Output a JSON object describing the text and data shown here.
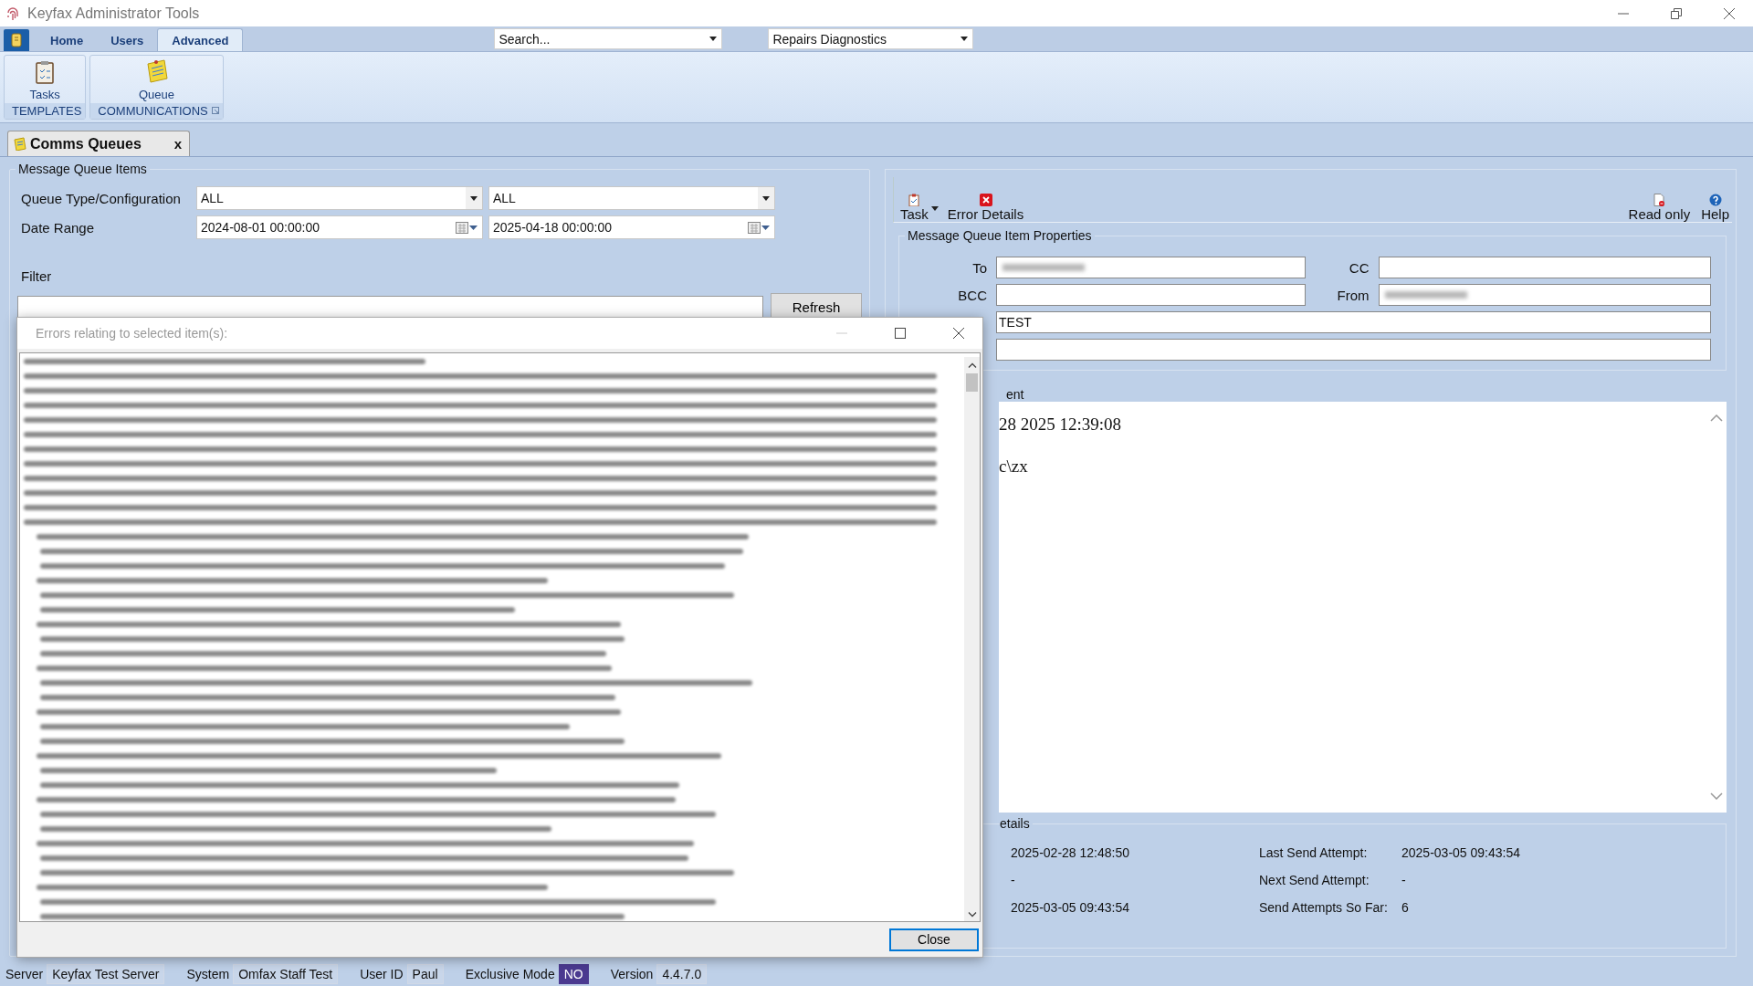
{
  "window": {
    "title": "Keyfax Administrator Tools"
  },
  "ribbon": {
    "tabs": [
      {
        "label": "Home",
        "selected": false
      },
      {
        "label": "Users",
        "selected": false
      },
      {
        "label": "Advanced",
        "selected": true
      }
    ],
    "search": {
      "placeholder": "Search..."
    },
    "view_select": {
      "value": "Repairs Diagnostics"
    },
    "groups": [
      {
        "buttons": [
          {
            "label": "Tasks",
            "kind": "tasks"
          }
        ],
        "label": "TEMPLATES",
        "launcher": false
      },
      {
        "buttons": [
          {
            "label": "Queue",
            "kind": "queue"
          }
        ],
        "label": "COMMUNICATIONS",
        "launcher": true
      }
    ]
  },
  "document_tabs": [
    {
      "label": "Comms Queues",
      "close": "x",
      "selected": true
    }
  ],
  "queue_items": {
    "title": "Message Queue Items",
    "queue_type": {
      "label": "Queue Type/Configuration",
      "values": [
        "ALL",
        "ALL"
      ]
    },
    "date_range": {
      "label": "Date Range",
      "values": [
        "2024-08-01 00:00:00",
        "2025-04-18 00:00:00"
      ]
    },
    "filter_label": "Filter",
    "refresh_button": "Refresh"
  },
  "item_panel": {
    "toolbar_left": [
      {
        "label": "Task",
        "kind": "task",
        "dropdown": true
      },
      {
        "label": "Error Details",
        "kind": "error",
        "dropdown": false
      }
    ],
    "toolbar_right": [
      {
        "label": "Read only",
        "kind": "readonly",
        "dropdown": false
      },
      {
        "label": "Help",
        "kind": "help",
        "dropdown": false
      }
    ],
    "properties": {
      "title": "Message Queue Item Properties",
      "fields": [
        {
          "label": "To",
          "kind": "half",
          "obscured": true
        },
        {
          "label": "CC",
          "kind": "half",
          "obscured": false
        },
        {
          "label": "BCC",
          "kind": "half",
          "obscured": false
        },
        {
          "label": "From",
          "kind": "half",
          "obscured": true
        },
        {
          "kind": "wide",
          "value": "TEST",
          "obscured": false
        },
        {
          "kind": "wide",
          "obscured": false
        }
      ]
    },
    "content": {
      "legend": "ent",
      "lines": [
        "28 2025 12:39:08",
        "c\\zx"
      ]
    },
    "details": {
      "legend": "etails",
      "rows": [
        {
          "value": "2025-02-28 12:48:50",
          "right_label": "Last Send Attempt:",
          "right_value": "2025-03-05 09:43:54"
        },
        {
          "value": "-",
          "right_label": "Next Send Attempt:",
          "right_value": "-"
        },
        {
          "value": "2025-03-05 09:43:54",
          "right_label": "Send Attempts So Far:",
          "right_value": "6"
        }
      ]
    }
  },
  "error_dialog": {
    "title": "Errors relating to selected item(s):",
    "close_button": "Close"
  },
  "status_bar": [
    {
      "label": "Server",
      "value": "Keyfax Test Server",
      "highlight": false
    },
    {
      "label": "System",
      "value": "Omfax Staff Test",
      "highlight": false
    },
    {
      "label": "User ID",
      "value": "Paul",
      "highlight": false
    },
    {
      "label": "Exclusive Mode",
      "value": "NO",
      "highlight": true
    },
    {
      "label": "Version",
      "value": "4.4.7.0",
      "highlight": false
    }
  ]
}
